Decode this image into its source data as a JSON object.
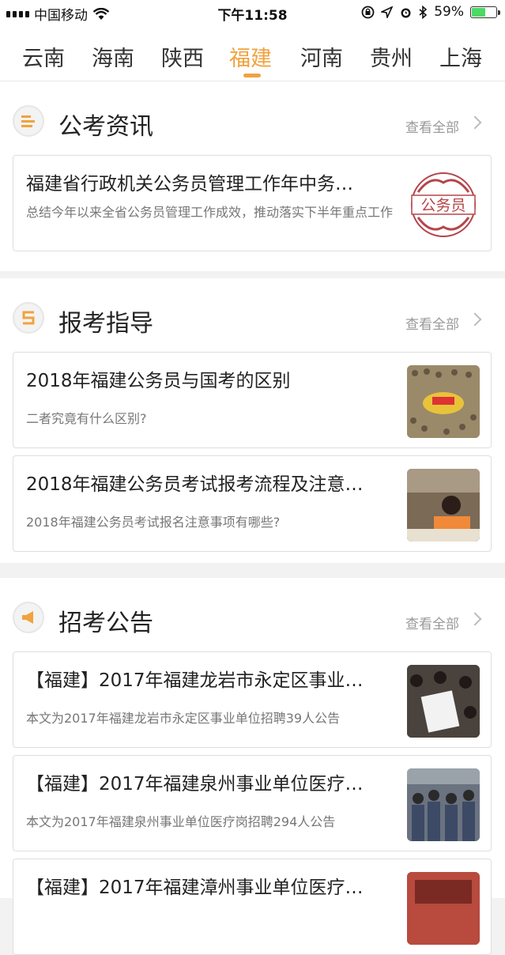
{
  "status": {
    "carrier": "中国移动",
    "time": "下午11:58",
    "battery": "59%",
    "battery_level": 0.59
  },
  "tabs": [
    "云南",
    "海南",
    "陕西",
    "福建",
    "河南",
    "贵州",
    "上海"
  ],
  "active_tab": "福建",
  "sections": [
    {
      "title": "公考资讯",
      "more": "查看全部",
      "items": [
        {
          "title": "福建省行政机关公务员管理工作年中务…",
          "desc": "总结今年以来全省公务员管理工作成效，推动落实下半年重点工作",
          "thumb_text": "公务员"
        }
      ]
    },
    {
      "title": "报考指导",
      "more": "查看全部",
      "items": [
        {
          "title": "2018年福建公务员与国考的区别",
          "desc": "二者究竟有什么区别?"
        },
        {
          "title": "2018年福建公务员考试报考流程及注意…",
          "desc": "2018年福建公务员考试报名注意事项有哪些?"
        }
      ]
    },
    {
      "title": "招考公告",
      "more": "查看全部",
      "items": [
        {
          "title": "【福建】2017年福建龙岩市永定区事业…",
          "desc": "本文为2017年福建龙岩市永定区事业单位招聘39人公告"
        },
        {
          "title": "【福建】2017年福建泉州事业单位医疗…",
          "desc": "本文为2017年福建泉州事业单位医疗岗招聘294人公告"
        },
        {
          "title": "【福建】2017年福建漳州事业单位医疗…",
          "desc": ""
        }
      ]
    }
  ]
}
